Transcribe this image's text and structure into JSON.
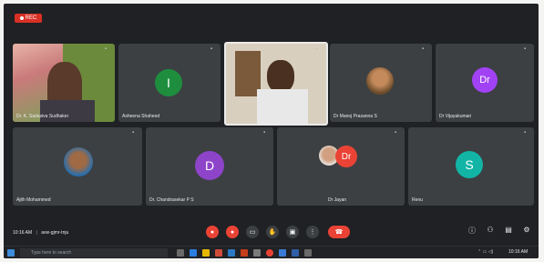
{
  "recording": {
    "label": "REC"
  },
  "participants_row1": [
    {
      "name": "Dr. K. Sadasiva Sudhaker",
      "type": "video"
    },
    {
      "name": "Asheena Shaheed",
      "initial": "I",
      "color": "#1e8e3e"
    },
    {
      "name": "",
      "type": "video"
    },
    {
      "name": "Dr Manoj Prasanna S",
      "type": "photo"
    },
    {
      "name": "Dr Vijayakumari",
      "initial": "Dr",
      "color": "#a142f4"
    }
  ],
  "participants_row2": [
    {
      "name": "Ajith Mohammed",
      "type": "photo"
    },
    {
      "name": "Dr. Chandrasekar P S",
      "initial": "D",
      "color": "#8e44c9"
    },
    {
      "name": "Dr Jayan",
      "initial": "Dr",
      "color": "#ea4335"
    },
    {
      "name": "Renu",
      "initial": "S",
      "color": "#12b5a5"
    }
  ],
  "meeting": {
    "time": "10:16 AM",
    "code": "avw-gjmr-tnju"
  },
  "controls": [
    {
      "icon": "mic-off-icon",
      "color": "#ea4335",
      "glyph": "●"
    },
    {
      "icon": "camera-off-icon",
      "color": "#ea4335",
      "glyph": "●"
    },
    {
      "icon": "captions-icon",
      "color": "#3c4043",
      "glyph": "▭"
    },
    {
      "icon": "hand-icon",
      "color": "#3c4043",
      "glyph": "✋"
    },
    {
      "icon": "present-icon",
      "color": "#3c4043",
      "glyph": "▣"
    },
    {
      "icon": "more-icon",
      "color": "#3c4043",
      "glyph": "⋮"
    },
    {
      "icon": "end-call-icon",
      "color": "#ea4335",
      "glyph": "☎"
    }
  ],
  "taskbar": {
    "search_placeholder": "Type here to search",
    "clock": "10:16 AM"
  }
}
